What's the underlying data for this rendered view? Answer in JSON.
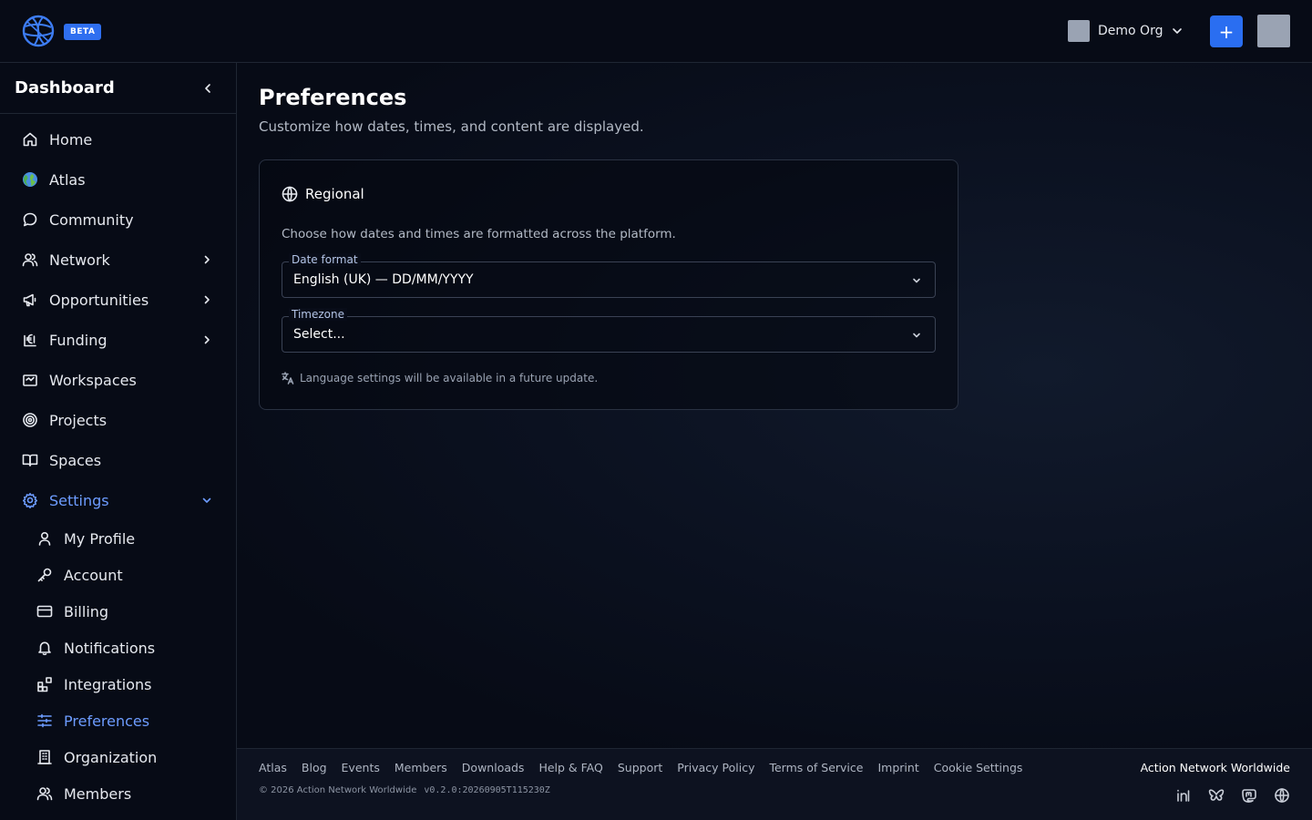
{
  "header": {
    "beta_label": "BETA",
    "org_name": "Demo Org",
    "create_label": "+"
  },
  "sidebar": {
    "title": "Dashboard",
    "items": [
      {
        "label": "Home",
        "icon": "home-icon"
      },
      {
        "label": "Atlas",
        "icon": "globe-emoji-icon"
      },
      {
        "label": "Community",
        "icon": "chat-bubble-icon"
      },
      {
        "label": "Network",
        "icon": "users-icon"
      },
      {
        "label": "Opportunities",
        "icon": "megaphone-icon"
      },
      {
        "label": "Funding",
        "icon": "euro-coins-icon"
      },
      {
        "label": "Workspaces",
        "icon": "briefcase-icon"
      },
      {
        "label": "Projects",
        "icon": "target-icon"
      },
      {
        "label": "Spaces",
        "icon": "book-open-icon"
      },
      {
        "label": "Settings",
        "icon": "gear-icon"
      }
    ],
    "settings_items": [
      {
        "label": "My Profile",
        "icon": "user-icon"
      },
      {
        "label": "Account",
        "icon": "key-icon"
      },
      {
        "label": "Billing",
        "icon": "credit-card-icon"
      },
      {
        "label": "Notifications",
        "icon": "bell-icon"
      },
      {
        "label": "Integrations",
        "icon": "blocks-icon"
      },
      {
        "label": "Preferences",
        "icon": "sliders-icon"
      },
      {
        "label": "Organization",
        "icon": "building-icon"
      },
      {
        "label": "Members",
        "icon": "users-icon"
      }
    ]
  },
  "main": {
    "title": "Preferences",
    "subtitle": "Customize how dates, times, and content are displayed.",
    "card": {
      "title": "Regional",
      "description": "Choose how dates and times are formatted across the platform.",
      "date_format": {
        "label": "Date format",
        "value": "English (UK) — DD/MM/YYYY"
      },
      "timezone": {
        "label": "Timezone",
        "value": "Select..."
      },
      "language_note": "Language settings will be available in a future update."
    }
  },
  "footer": {
    "links": [
      "Atlas",
      "Blog",
      "Events",
      "Members",
      "Downloads",
      "Help & FAQ",
      "Support",
      "Privacy Policy",
      "Terms of Service",
      "Imprint",
      "Cookie Settings"
    ],
    "copyright": "© 2026 Action Network Worldwide",
    "version": "v0.2.0:20260905T115230Z",
    "org": "Action Network Worldwide",
    "social": [
      "linkedin-icon",
      "bluesky-icon",
      "mastodon-icon",
      "globe-icon"
    ]
  },
  "colors": {
    "background": "#070b16",
    "accent": "#2a6ef1",
    "active_nav": "#6d9cff"
  }
}
